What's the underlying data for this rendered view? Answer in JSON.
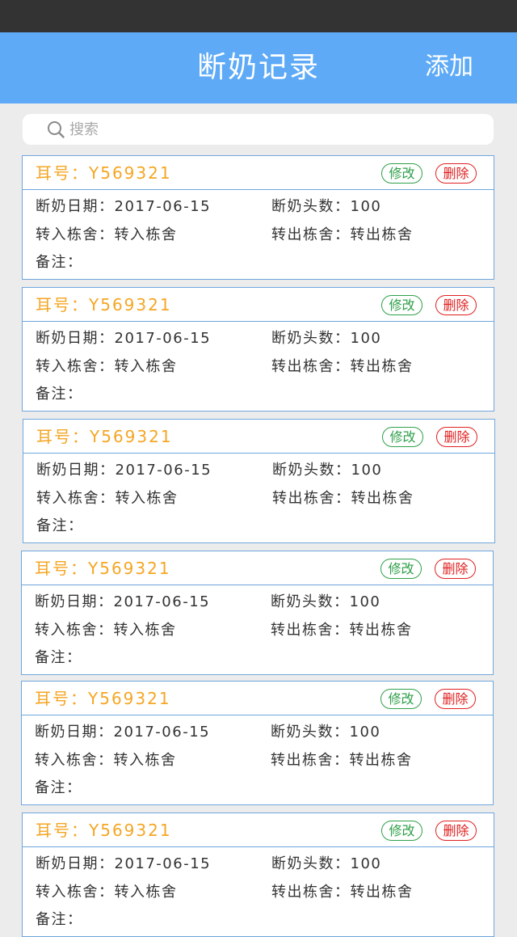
{
  "header": {
    "title": "断奶记录",
    "action_label": "添加"
  },
  "search": {
    "placeholder": "搜索",
    "value": ""
  },
  "labels": {
    "ear": "耳号：",
    "date": "断奶日期：",
    "count": "断奶头数：",
    "in_barn": "转入栋舍：",
    "out_barn": "转出栋舍：",
    "note": "备注：",
    "edit": "修改",
    "delete": "删除"
  },
  "records": [
    {
      "ear_no": "Y569321",
      "date": "2017-06-15",
      "count": "100",
      "in_barn": "转入栋舍",
      "out_barn": "转出栋舍",
      "note": ""
    },
    {
      "ear_no": "Y569321",
      "date": "2017-06-15",
      "count": "100",
      "in_barn": "转入栋舍",
      "out_barn": "转出栋舍",
      "note": ""
    },
    {
      "ear_no": "Y569321",
      "date": "2017-06-15",
      "count": "100",
      "in_barn": "转入栋舍",
      "out_barn": "转出栋舍",
      "note": ""
    },
    {
      "ear_no": "Y569321",
      "date": "2017-06-15",
      "count": "100",
      "in_barn": "转入栋舍",
      "out_barn": "转出栋舍",
      "note": ""
    },
    {
      "ear_no": "Y569321",
      "date": "2017-06-15",
      "count": "100",
      "in_barn": "转入栋舍",
      "out_barn": "转出栋舍",
      "note": ""
    },
    {
      "ear_no": "Y569321",
      "date": "2017-06-15",
      "count": "100",
      "in_barn": "转入栋舍",
      "out_barn": "转出栋舍",
      "note": ""
    }
  ],
  "colors": {
    "nav": "#5eaaf6",
    "ear_text": "#f5a623",
    "edit": "#2fa04a",
    "delete": "#e02020",
    "card_border": "#6fa6dc"
  },
  "icons": {
    "search": "search-icon"
  }
}
